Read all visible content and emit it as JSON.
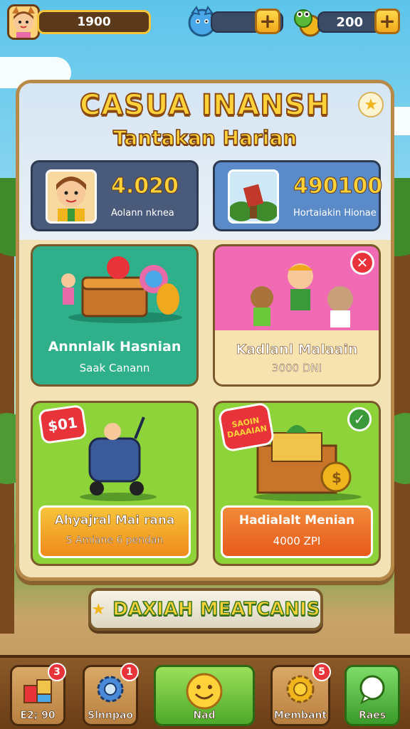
{
  "topbar": {
    "score": "1900",
    "gems": "",
    "coins": "200",
    "add_label": "+"
  },
  "panel": {
    "title": "CASUA INANSH",
    "subtitle": "Tantakan Harian",
    "star_glyph": "★",
    "stats": [
      {
        "value": "4.020",
        "label": "Aolann nknea",
        "icon": "boy-portrait"
      },
      {
        "value": "490100",
        "label": "Hortaiakin Hionae",
        "icon": "jungle-gift"
      }
    ],
    "tiles": [
      {
        "title": "Annnlalk Hasnian",
        "sub": "Saak Canann",
        "color": "#2fb08a",
        "badge": ""
      },
      {
        "title": "Kadlanl Malaain",
        "sub": "3000 DNI",
        "color": "#f06ab4",
        "badge": "✕"
      },
      {
        "title": "Ahyajral Mai rana",
        "sub": "S Amiane 6 pendan",
        "color": "#8fd33a",
        "tag": "$01"
      },
      {
        "title": "Hadialalt Menian",
        "sub": "4000 ZPI",
        "color": "#8fd33a",
        "tag_lines": [
          "SAOIN",
          "DAAAIAN"
        ],
        "badge": "✓"
      }
    ],
    "claim_label": "DAXIAH MEATCANIS"
  },
  "bottomnav": [
    {
      "label": "E2; 90",
      "notif": "3",
      "icon": "blocks-icon"
    },
    {
      "label": "Slnnpao",
      "notif": "1",
      "icon": "gear-icon"
    },
    {
      "label": "Nad",
      "notif": "",
      "icon": "smiley-icon"
    },
    {
      "label": "Membant",
      "notif": "5",
      "icon": "cog-gold-icon"
    },
    {
      "label": "Raes",
      "notif": "",
      "icon": "chat-icon"
    }
  ],
  "colors": {
    "accent_gold": "#ffd23a",
    "panel_bg": "#f3e2b6",
    "wood": "#b88a4a",
    "red_badge": "#e8333a"
  }
}
